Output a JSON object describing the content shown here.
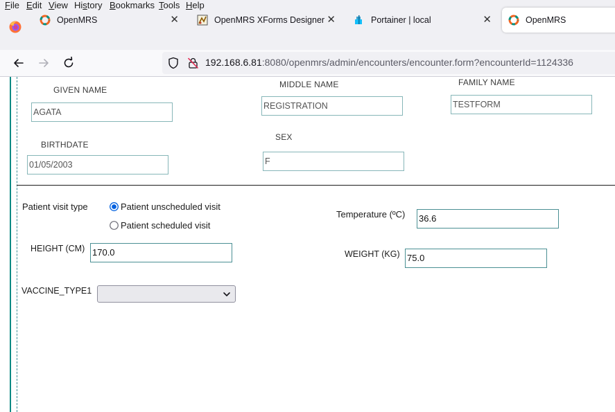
{
  "menu": [
    "File",
    "Edit",
    "View",
    "History",
    "Bookmarks",
    "Tools",
    "Help"
  ],
  "menu_underline": [
    "F",
    "E",
    "V",
    "s",
    "B",
    "T",
    "H"
  ],
  "tabs": [
    {
      "title": "OpenMRS",
      "icon": "openmrs-logo-icon"
    },
    {
      "title": "OpenMRS XForms Designer",
      "icon": "xforms-designer-icon"
    },
    {
      "title": "Portainer | local",
      "icon": "portainer-icon"
    },
    {
      "title": "OpenMRS",
      "icon": "openmrs-logo-icon"
    }
  ],
  "url": {
    "host": "192.168.6.81",
    "path": ":8080/openmrs/admin/encounters/encounter.form?encounterId=1124336"
  },
  "form": {
    "given_name_label": "GIVEN NAME",
    "given_name_value": "AGATA",
    "middle_name_label": "MIDDLE NAME",
    "middle_name_value": "REGISTRATION",
    "family_name_label": "FAMILY NAME",
    "family_name_value": "TESTFORM",
    "birthdate_label": "BIRTHDATE",
    "birthdate_value": "01/05/2003",
    "sex_label": "SEX",
    "sex_value": "F",
    "visit_type_label": "Patient visit type",
    "visit_options": [
      "Patient unscheduled visit",
      "Patient scheduled visit"
    ],
    "visit_selected": "Patient unscheduled visit",
    "temperature_label": "Temperature (ºC)",
    "temperature_value": "36.6",
    "height_label": "HEIGHT (CM)",
    "height_value": "170.0",
    "weight_label": "WEIGHT (KG)",
    "weight_value": "75.0",
    "vaccine_label": "VACCINE_TYPE1",
    "vaccine_value": ""
  },
  "colors": {
    "accent": "#0d8a84",
    "radio_selected": "#0060df",
    "field_border": "#86b6b8"
  }
}
